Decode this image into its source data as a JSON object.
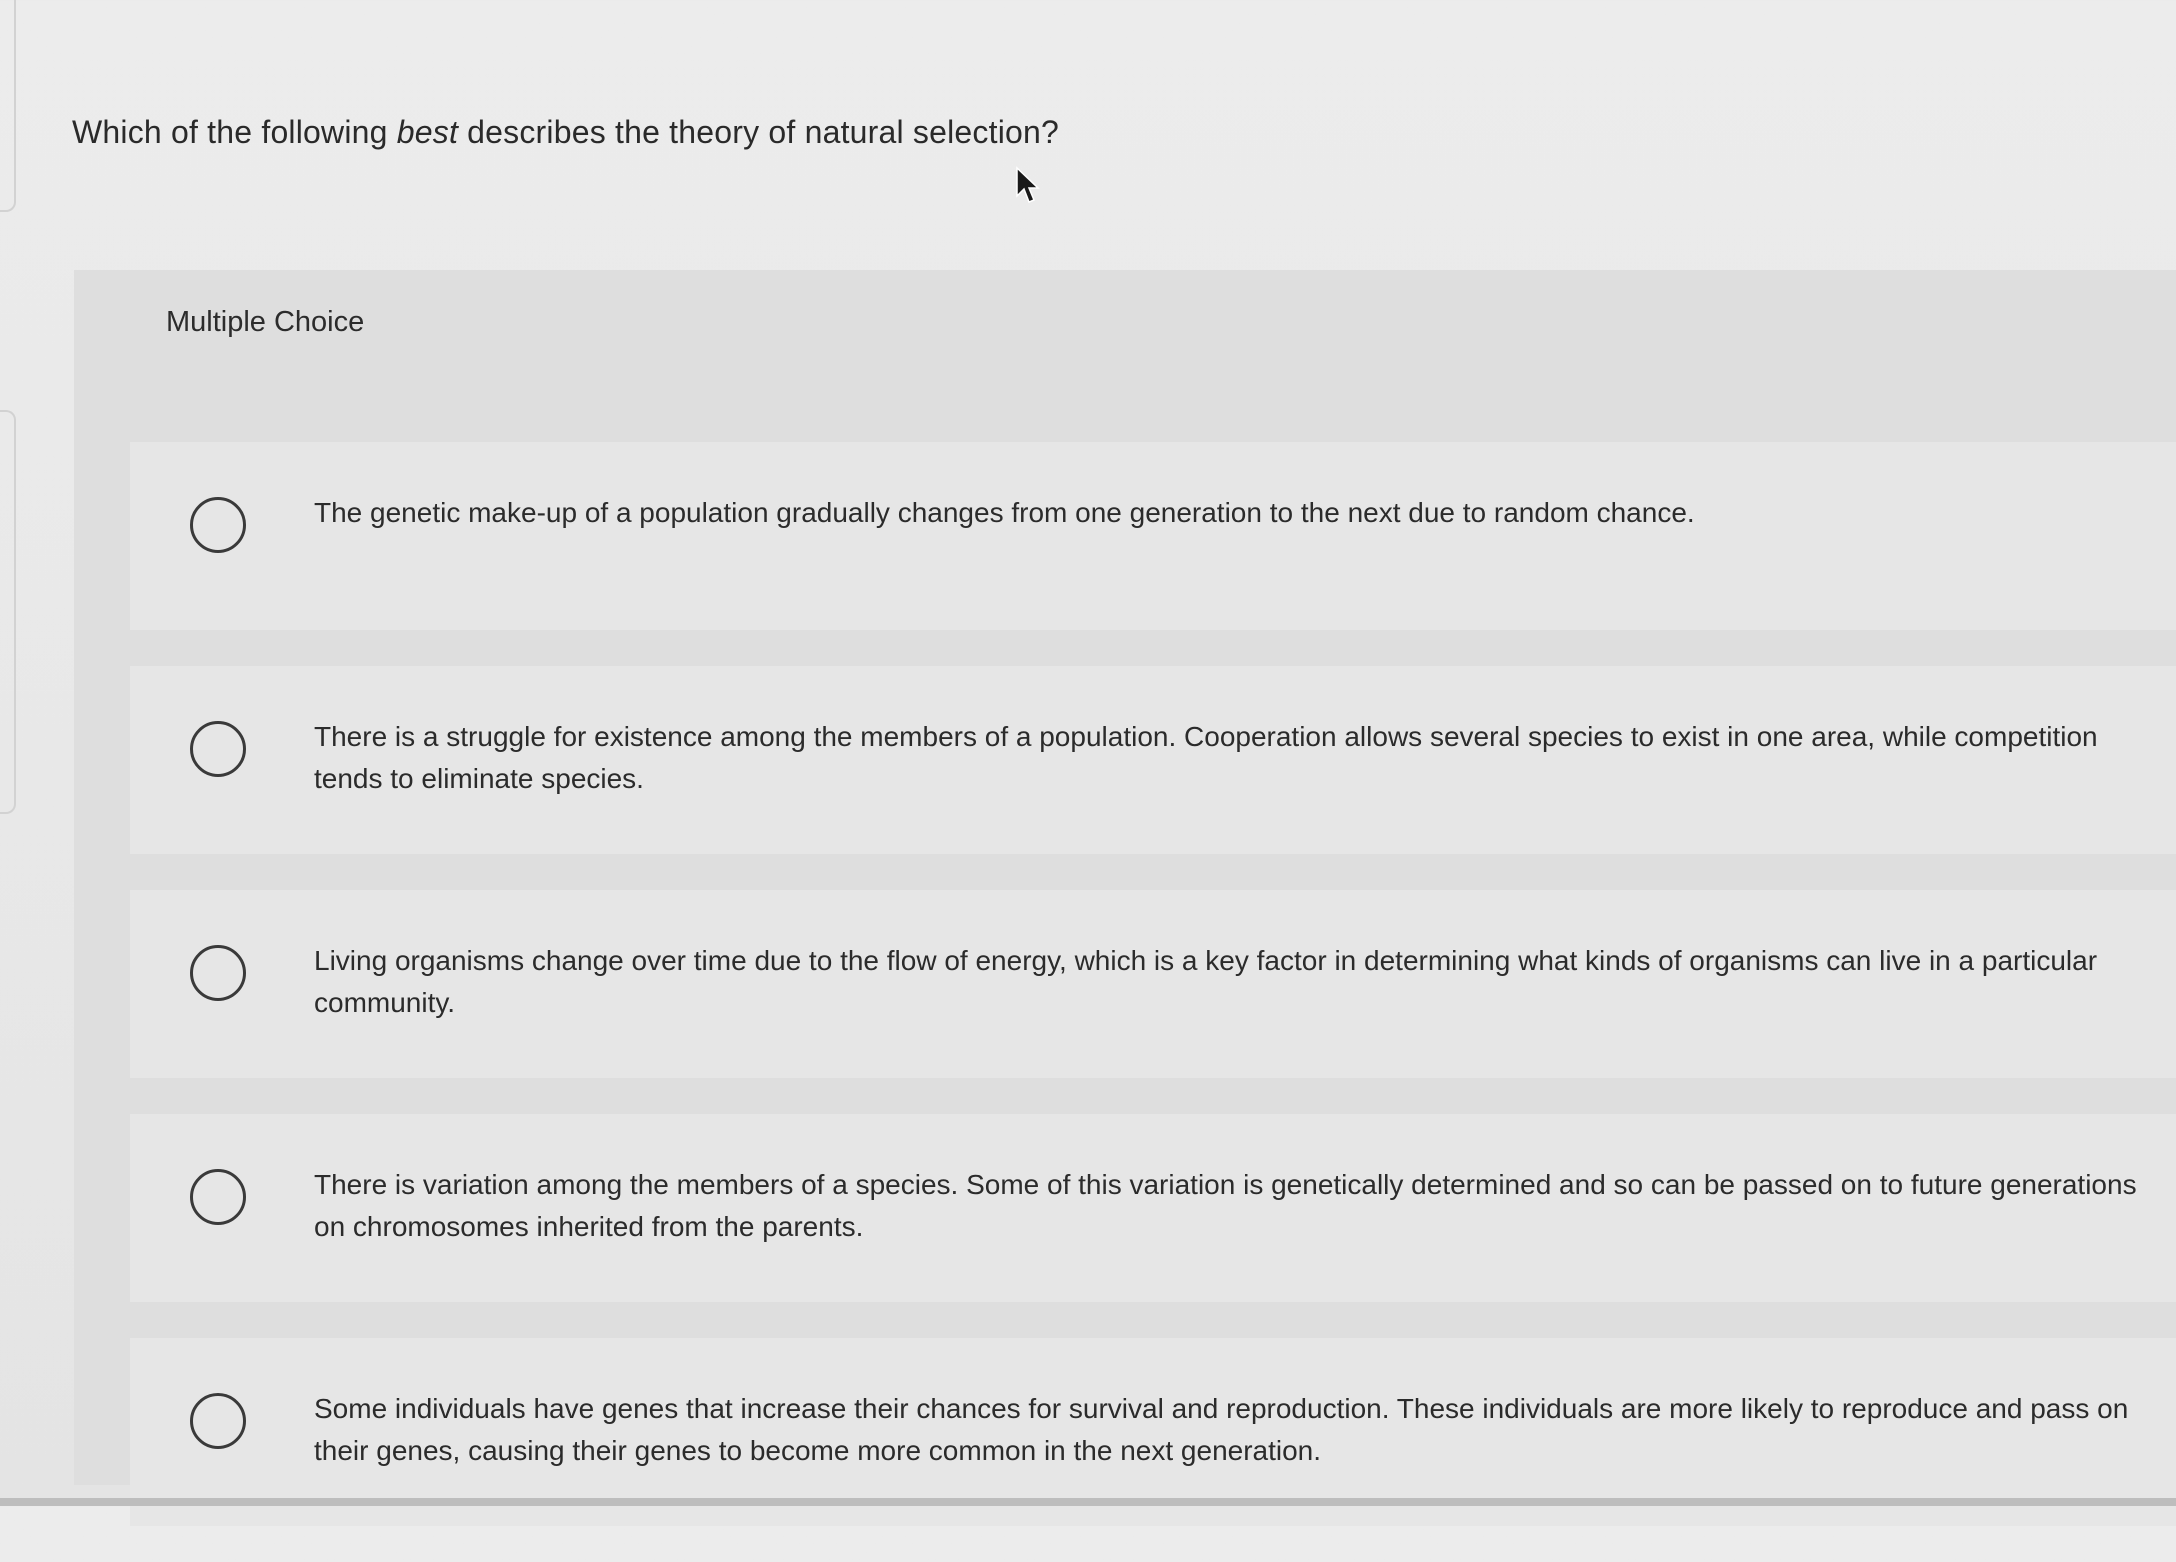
{
  "question": {
    "before": "Which of the following ",
    "emphasis": "best",
    "after": " describes the theory of natural selection?"
  },
  "mc_label": "Multiple Choice",
  "choices": [
    {
      "text": "The genetic make-up of a population gradually changes from one generation to the next due to random chance."
    },
    {
      "text": "There is a struggle for existence among the members of a population. Cooperation allows several species to exist in one area, while competition tends to eliminate species."
    },
    {
      "text": "Living organisms change over time due to the flow of energy, which is a key factor in determining what kinds of organisms can live in a particular community."
    },
    {
      "text": "There is variation among the members of a species. Some of this variation is genetically determined and so can be passed on to future generations on chromosomes inherited from the parents."
    },
    {
      "text": "Some individuals have genes that increase their chances for survival and reproduction. These individuals are more likely to reproduce and pass on their genes, causing their genes to become more common in the next generation."
    }
  ],
  "icons": {
    "cursor": "mouse-pointer-icon",
    "radio": "radio-button-icon"
  }
}
